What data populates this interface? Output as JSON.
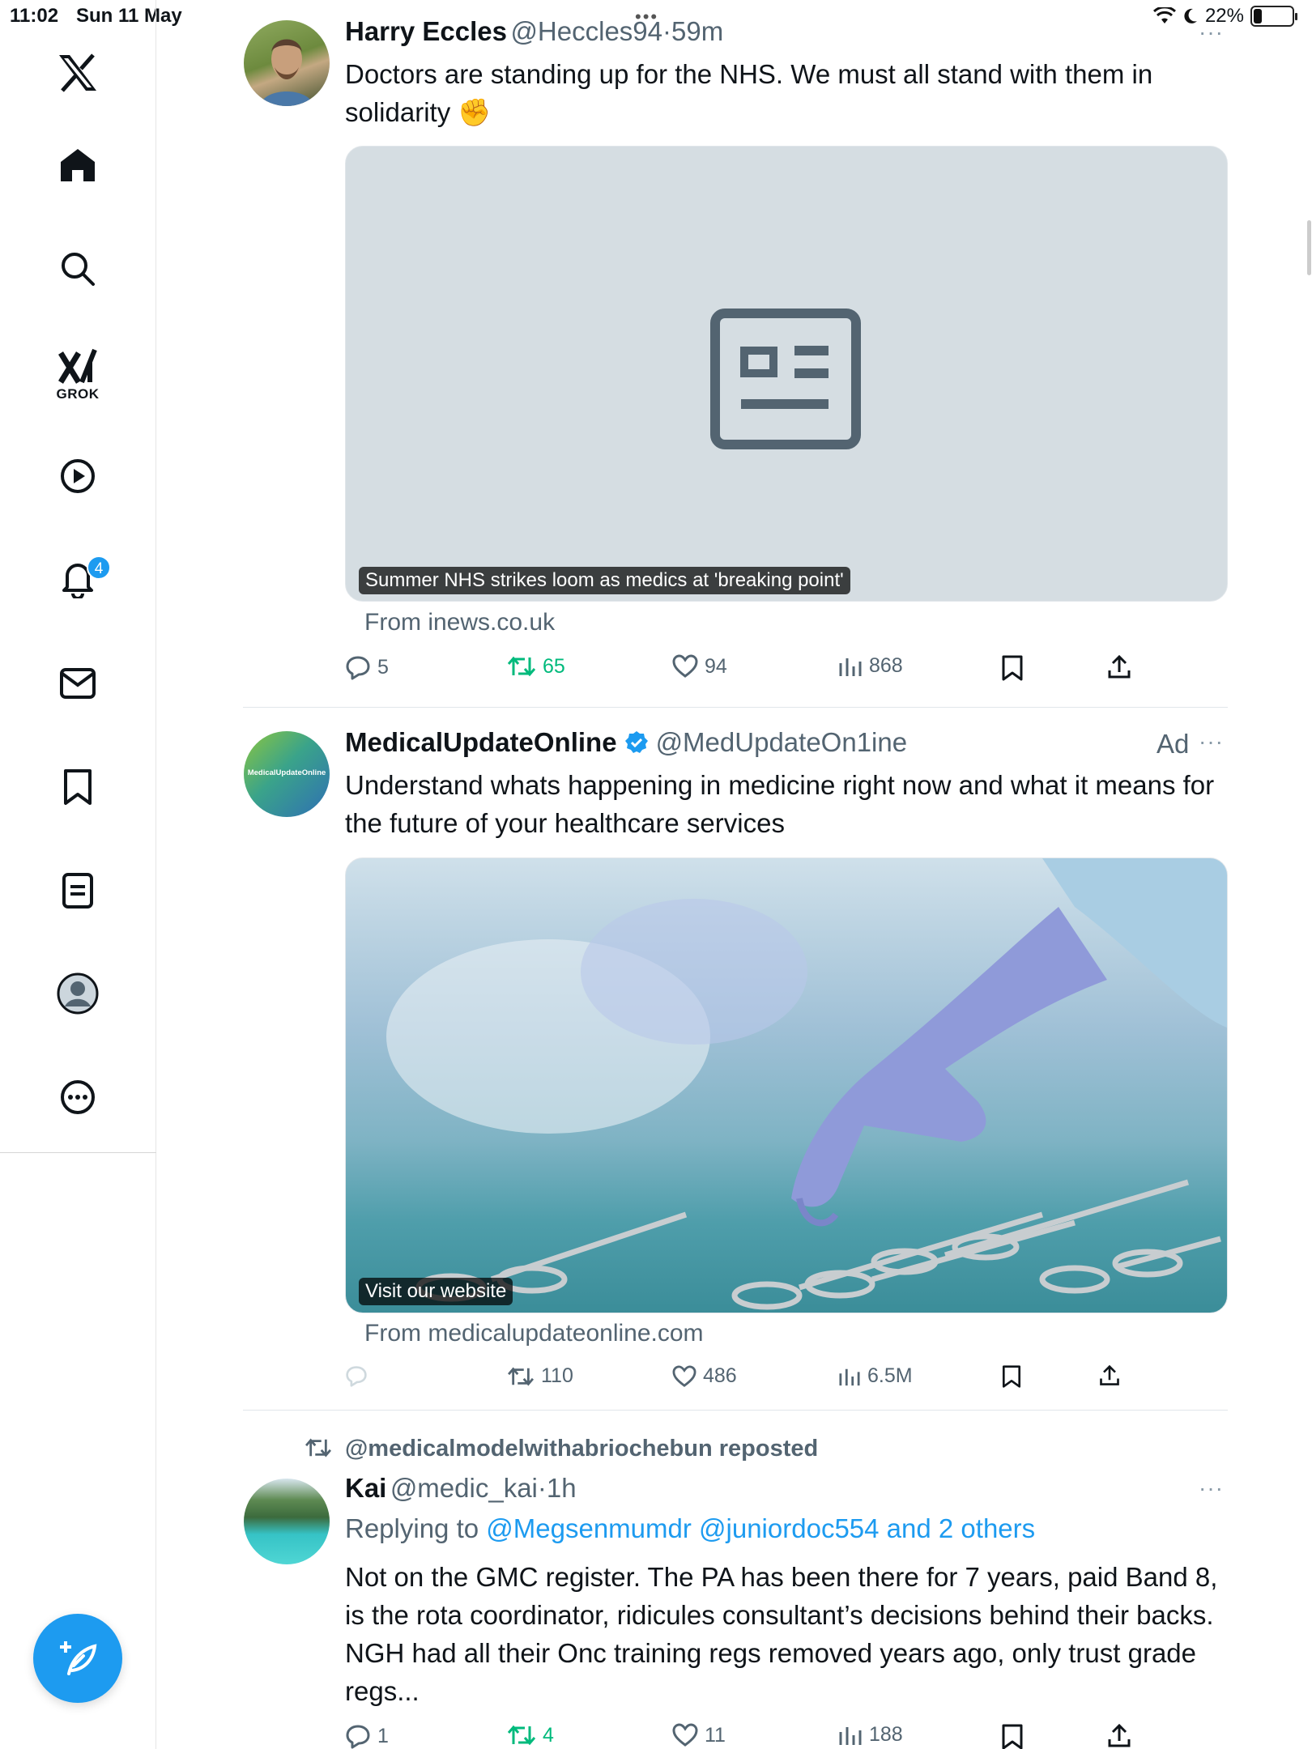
{
  "status_bar": {
    "time": "11:02",
    "date": "Sun 11 May",
    "battery": "22%",
    "battery_level": 0.22,
    "top_dots": "•••"
  },
  "sidebar": {
    "grok_label": "GROK",
    "notification_count": "4",
    "items": [
      "x-logo",
      "home",
      "search",
      "grok",
      "video",
      "notifications",
      "messages",
      "bookmarks",
      "lists",
      "profile",
      "more"
    ]
  },
  "colors": {
    "accent": "#1d9bf0",
    "retweet_green": "#00ba7c",
    "muted": "#536471"
  },
  "tweets": [
    {
      "name": "Harry Eccles",
      "handle": "@Heccles94",
      "time": "59m",
      "text": "Doctors are standing up for the NHS. We must all stand with them in solidarity ✊",
      "card_caption": "Summer NHS strikes loom as medics at 'breaking point'",
      "card_source": "From inews.co.uk",
      "replies": "5",
      "retweets": "65",
      "likes": "94",
      "views": "868"
    },
    {
      "name": "MedicalUpdateOnline",
      "handle": "@MedUpdateOn1ine",
      "ad_label": "Ad",
      "avatar_text": "MedicalUpdateOnline",
      "text": "Understand whats happening in medicine right now and what it means for the future of your healthcare services",
      "card_caption": "Visit our website",
      "card_source": "From medicalupdateonline.com",
      "retweets": "110",
      "likes": "486",
      "views": "6.5M"
    },
    {
      "repost_by": "@medicalmodelwithabriochebun reposted",
      "name": "Kai",
      "handle": "@medic_kai",
      "time": "1h",
      "replying_prefix": "Replying to",
      "replying_to": "@Megsenmumdr @juniordoc554 and 2 others",
      "text": "Not on the GMC register. The PA has been there for 7 years, paid Band 8, is the rota coordinator, ridicules consultant’s decisions behind their backs. NGH had all their Onc training regs removed years ago, only trust grade regs...",
      "replies": "1",
      "retweets": "4",
      "likes": "11",
      "views": "188"
    }
  ]
}
